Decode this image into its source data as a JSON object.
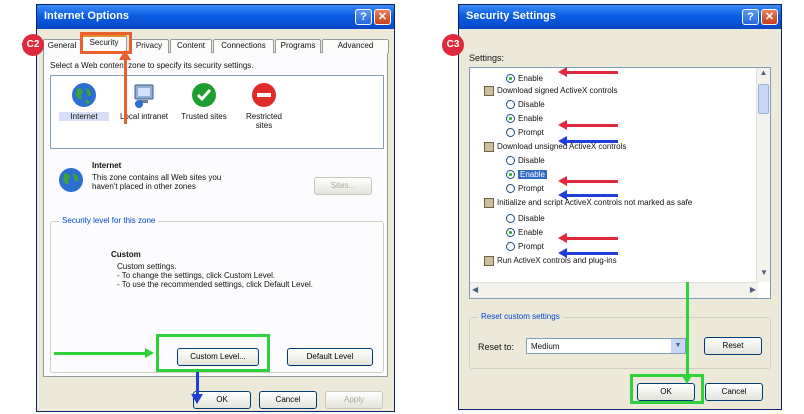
{
  "callouts": {
    "c2": "C2",
    "c3": "C3"
  },
  "internet_options": {
    "title": "Internet Options",
    "help_glyph": "?",
    "close_glyph": "✕",
    "tabs": [
      "General",
      "Security",
      "Privacy",
      "Content",
      "Connections",
      "Programs",
      "Advanced"
    ],
    "active_tab": "Security",
    "zone_prompt": "Select a Web content zone to specify its security settings.",
    "zones": [
      {
        "label": "Internet",
        "icon": "globe-icon"
      },
      {
        "label": "Local intranet",
        "icon": "computer-icon"
      },
      {
        "label": "Trusted sites",
        "icon": "checkmark-icon"
      },
      {
        "label": "Restricted sites",
        "icon": "no-entry-icon"
      }
    ],
    "selected_zone": {
      "title": "Internet",
      "description": "This zone contains all Web sites you haven't placed in other zones"
    },
    "sites_button": "Sites...",
    "security_level_group": "Security level for this zone",
    "custom": {
      "title": "Custom",
      "line1": "Custom settings.",
      "line2": "- To change the settings, click Custom Level.",
      "line3": "- To use the recommended settings, click Default Level."
    },
    "custom_level_button": "Custom Level...",
    "default_level_button": "Default Level",
    "ok_button": "OK",
    "cancel_button": "Cancel",
    "apply_button": "Apply"
  },
  "security_settings": {
    "title": "Security Settings",
    "help_glyph": "?",
    "close_glyph": "✕",
    "settings_label": "Settings:",
    "items": [
      {
        "type": "option",
        "label": "Enable",
        "checked": true
      },
      {
        "type": "category",
        "label": "Download signed ActiveX controls"
      },
      {
        "type": "option",
        "label": "Disable",
        "checked": false
      },
      {
        "type": "option",
        "label": "Enable",
        "checked": true
      },
      {
        "type": "option",
        "label": "Prompt",
        "checked": false
      },
      {
        "type": "category",
        "label": "Download unsigned ActiveX controls"
      },
      {
        "type": "option",
        "label": "Disable",
        "checked": false
      },
      {
        "type": "option",
        "label": "Enable",
        "checked": true,
        "selected": true
      },
      {
        "type": "option",
        "label": "Prompt",
        "checked": false
      },
      {
        "type": "category",
        "label": "Initialize and script ActiveX controls not marked as safe"
      },
      {
        "type": "option",
        "label": "Disable",
        "checked": false
      },
      {
        "type": "option",
        "label": "Enable",
        "checked": true
      },
      {
        "type": "option",
        "label": "Prompt",
        "checked": false
      },
      {
        "type": "category",
        "label": "Run ActiveX controls and plug-ins"
      }
    ],
    "reset_group": "Reset custom settings",
    "reset_to_label": "Reset to:",
    "reset_to_value": "Medium",
    "reset_button": "Reset",
    "ok_button": "OK",
    "cancel_button": "Cancel"
  },
  "colors": {
    "highlight_orange": "#e8602c",
    "highlight_green": "#2fd13a",
    "arrow_red": "#e0293c",
    "arrow_blue": "#1f3fd6",
    "arrow_green": "#2fd13a"
  }
}
